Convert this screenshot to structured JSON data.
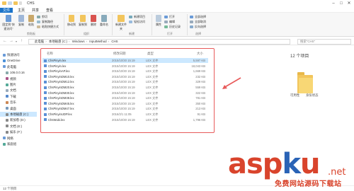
{
  "window": {
    "title": "CHS"
  },
  "menu": [
    "文件",
    "主页",
    "共享",
    "查看"
  ],
  "ribbon": {
    "clipboard": {
      "pin_label": "固定到\"快速访问\"",
      "copy_label": "复制",
      "paste_label": "粘贴",
      "cut_label": "剪切",
      "copy_path_label": "复制路径",
      "paste_shortcut_label": "粘贴快捷方式",
      "group": "剪贴板"
    },
    "organize": {
      "move_label": "移动到",
      "copyto_label": "复制到",
      "delete_label": "删除",
      "rename_label": "重命名",
      "group": "组织"
    },
    "new": {
      "newfolder_label": "新建文件夹",
      "newitem_label": "新建项目",
      "easy_access_label": "轻松访问",
      "group": "新建"
    },
    "open": {
      "properties_label": "属性",
      "open_label": "打开",
      "edit_label": "编辑",
      "history_label": "历史记录",
      "group": "打开"
    },
    "select": {
      "all_label": "全部选择",
      "none_label": "全部取消",
      "invert_label": "反向选择",
      "group": "选择"
    }
  },
  "address": {
    "crumbs": [
      "此电脑",
      "本地磁盘 (C:)",
      "Windows",
      "InputMethod",
      "CHS"
    ],
    "search_placeholder": "搜索\"CHS\""
  },
  "nav": {
    "items": [
      {
        "label": "快速访问",
        "level": 0
      },
      {
        "label": "OneDrive",
        "level": 0
      },
      {
        "label": "此电脑",
        "level": 0
      },
      {
        "label": "106.0.0.16",
        "level": 1
      },
      {
        "label": "视频",
        "level": 1
      },
      {
        "label": "图片",
        "level": 1
      },
      {
        "label": "文档",
        "level": 1
      },
      {
        "label": "下载",
        "level": 1
      },
      {
        "label": "音乐",
        "level": 1
      },
      {
        "label": "桌面",
        "level": 1
      },
      {
        "label": "本地磁盘 (C:)",
        "level": 1,
        "selected": true
      },
      {
        "label": "新加卷 (D:)",
        "level": 1
      },
      {
        "label": "文档 (E:)",
        "level": 1
      },
      {
        "label": "娱乐 (F:)",
        "level": 1
      },
      {
        "label": "网络",
        "level": 0
      },
      {
        "label": "家庭组",
        "level": 0
      }
    ]
  },
  "files": {
    "columns": {
      "name": "名称",
      "date": "修改日期",
      "type": "类型",
      "size": "大小"
    },
    "rows": [
      {
        "name": "ChsPinyin.lex",
        "date": "2015/10/30 15:19",
        "type": "LEX 文件",
        "size": "5,597 KB",
        "selected": true
      },
      {
        "name": "ChsPinyin.lex",
        "date": "2015/10/30 15:19",
        "type": "LEX 文件",
        "size": "18,043 KB"
      },
      {
        "name": "ChsPinyinAP.lex",
        "date": "2015/10/30 15:19",
        "type": "LEX 文件",
        "size": "1,669 KB"
      },
      {
        "name": "ChsPinyinDM10.lex",
        "date": "2015/10/30 15:19",
        "type": "LEX 文件",
        "size": "232 KB"
      },
      {
        "name": "ChsPinyinDM12.lex",
        "date": "2015/10/30 15:19",
        "type": "LEX 文件",
        "size": "329 KB"
      },
      {
        "name": "ChsPinyinDM20.lex",
        "date": "2015/10/30 15:19",
        "type": "LEX 文件",
        "size": "559 KB"
      },
      {
        "name": "ChsPinyinDM30.lex",
        "date": "2015/10/30 15:19",
        "type": "LEX 文件",
        "size": "322 KB"
      },
      {
        "name": "ChsPinyinDM38.lex",
        "date": "2015/10/30 15:19",
        "type": "LEX 文件",
        "size": "781 KB"
      },
      {
        "name": "ChsPinyinDM45.lex",
        "date": "2015/10/30 15:19",
        "type": "LEX 文件",
        "size": "350 KB"
      },
      {
        "name": "ChsPinyinDM47.lex",
        "date": "2015/10/30 15:19",
        "type": "LEX 文件",
        "size": "213 KB"
      },
      {
        "name": "ChsPinyinUDP.lex",
        "date": "2016/2/1 11:05",
        "type": "LEX 文件",
        "size": "91 KB"
      },
      {
        "name": "ChsWubi.lex",
        "date": "2015/10/30 15:19",
        "type": "LEX 文件",
        "size": "1,796 KB"
      }
    ]
  },
  "preview": {
    "count": "12 个项目",
    "open_label": "可用性",
    "desc_label": "身份状态"
  },
  "status": {
    "text": "12 个项目"
  },
  "watermark": {
    "brand": "aspku",
    "tld": ".net",
    "sub": "免费网站源码下载站"
  },
  "colors": {
    "accent": "#1a73c9",
    "highlight": "#e85a5a",
    "selection": "#cce8ff",
    "folder": "#f2c55c"
  }
}
